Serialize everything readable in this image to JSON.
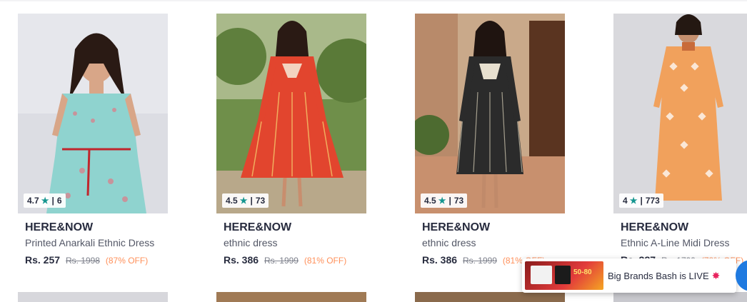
{
  "products": [
    {
      "rating": "4.7",
      "rating_count": "6",
      "brand": "HERE&NOW",
      "name": "Printed Anarkali Ethnic Dress",
      "price": "Rs. 257",
      "mrp": "Rs. 1998",
      "discount": "(87% OFF)"
    },
    {
      "rating": "4.5",
      "rating_count": "73",
      "brand": "HERE&NOW",
      "name": "ethnic dress",
      "price": "Rs. 386",
      "mrp": "Rs. 1999",
      "discount": "(81% OFF)"
    },
    {
      "rating": "4.5",
      "rating_count": "73",
      "brand": "HERE&NOW",
      "name": "ethnic dress",
      "price": "Rs. 386",
      "mrp": "Rs. 1999",
      "discount": "(81% OFF)"
    },
    {
      "rating": "4",
      "rating_count": "773",
      "brand": "HERE&NOW",
      "name": "Ethnic A-Line Midi Dress",
      "price": "Rs. 387",
      "mrp": "Rs. 1799",
      "discount": "(78% OFF)"
    }
  ],
  "toast": {
    "text": "Big Brands Bash is LIVE",
    "thumb_text": "50-80"
  },
  "icons": {
    "star": "star-icon",
    "burst": "burst-icon"
  },
  "colors": {
    "rating_star": "#14958f",
    "discount": "#ff905a",
    "brand_text": "#282c3f",
    "fab": "#1f7ae0"
  }
}
